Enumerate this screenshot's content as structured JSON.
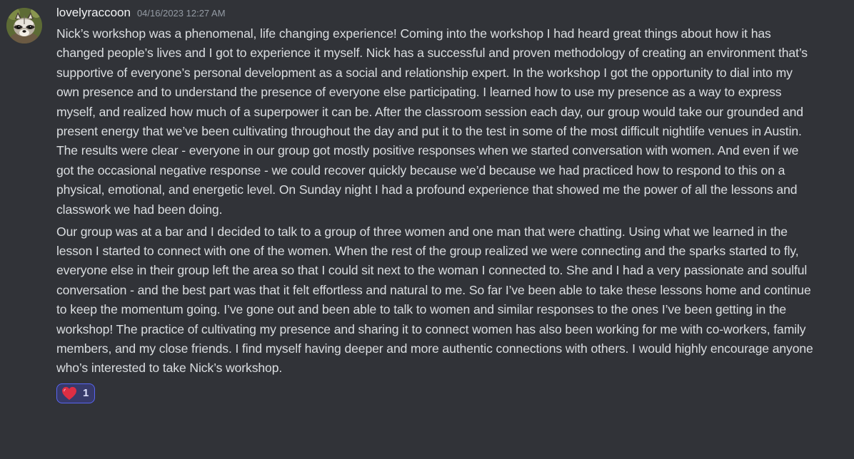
{
  "message": {
    "author": {
      "username": "lovelyraccoon",
      "avatar_icon": "raccoon-avatar-icon"
    },
    "timestamp": "04/16/2023 12:27 AM",
    "paragraphs": [
      "Nick’s workshop was a phenomenal, life changing experience! Coming into the workshop I had heard great things about how it has changed people’s lives and I got to experience it myself. Nick has a successful and proven methodology of creating an environment that’s supportive of everyone’s personal development as a social and relationship expert. In the workshop I got the opportunity to dial into my own presence and to understand the presence of everyone else participating. I learned how to use my presence as a way to express myself, and realized how much of a superpower it can be. After the classroom session each day, our group would take our grounded and present energy that we’ve been cultivating throughout the day and put it to the test in some of the most difficult nightlife venues in Austin. The results were clear - everyone in our group got mostly positive responses when we started conversation with women. And even if we got the occasional negative response - we could recover quickly because we’d because we had practiced how to respond to this on a physical, emotional, and energetic level. On Sunday night I had a profound experience that showed me the power of all the lessons and classwork we had been doing.",
      "Our group was at a bar and I decided to talk to a group of three women and one man that were chatting. Using what we learned in the lesson I started to connect with one of the women. When the rest of the group realized we were connecting and the sparks started to fly, everyone else in their group left the area so that I could sit next to the woman I connected to. She and I had a very passionate and soulful conversation - and the best part was that it felt effortless and natural to me. So far I’ve been able to take these lessons home and continue to keep the momentum going. I’ve gone out and been able to talk to women and similar responses to the ones I’ve been getting in the workshop! The practice of cultivating my presence and sharing it to connect women has also been working for me with co-workers, family members, and my close friends. I find myself having deeper and more authentic connections with others. I would highly encourage anyone who’s interested to take Nick’s workshop."
    ],
    "reactions": [
      {
        "emoji_icon": "red-heart-icon",
        "count": "1",
        "reacted": true
      }
    ]
  },
  "colors": {
    "background": "#313338",
    "text": "#dbdee1",
    "username": "#f2f3f5",
    "timestamp": "#949ba4",
    "reaction_border": "#5865f2",
    "reaction_bg": "#373a6a",
    "heart": "#dd2e44"
  }
}
